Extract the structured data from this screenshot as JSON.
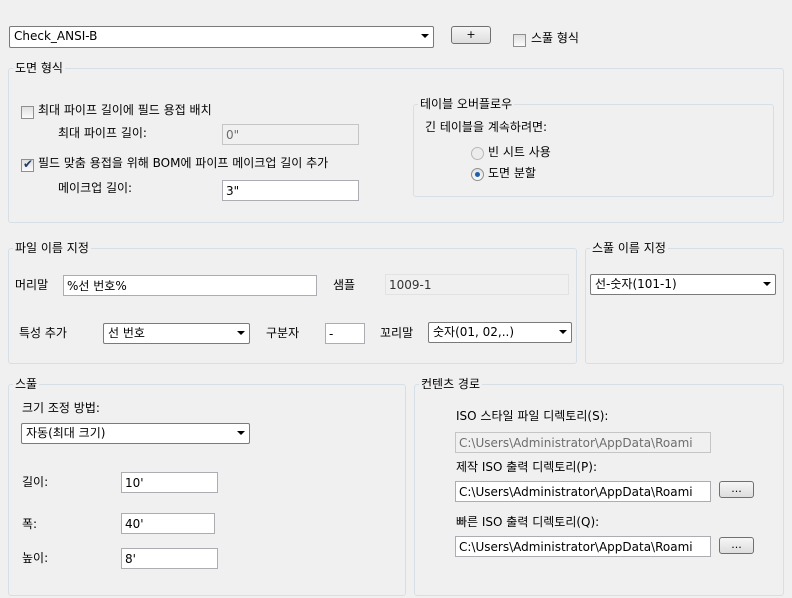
{
  "top": {
    "spool_combo": "Check_ANSI-B",
    "add_button": "+",
    "spool_format_label": "스풀 형식",
    "spool_format_checked": false
  },
  "drawing_format": {
    "title": "도면 형식",
    "field_weld_label": "최대 파이프 길이에 필드 용접 배치",
    "field_weld_checked": false,
    "max_pipe_label": "최대 파이프 길이:",
    "max_pipe_value": "0\"",
    "makeup_check_label": "필드 맞춤 용접을 위해 BOM에 파이프 메이크업 길이 추가",
    "makeup_checked": true,
    "makeup_length_label": "메이크업 길이:",
    "makeup_length_value": "3\""
  },
  "table_overflow": {
    "title": "테이블 오버플로우",
    "prompt": "긴 테이블을 계속하려면:",
    "option_blank": "빈 시트 사용",
    "option_split": "도면 분할",
    "selected": "split"
  },
  "file_naming": {
    "title": "파일 이름 지정",
    "prefix_label": "머리말",
    "prefix_value": "%선 번호%",
    "sample_label": "샘플",
    "sample_value": "1009-1",
    "property_label": "특성 추가",
    "property_value": "선 번호",
    "separator_label": "구분자",
    "separator_value": "-",
    "suffix_label": "꼬리말",
    "suffix_value": "숫자(01, 02,..)"
  },
  "spool_naming": {
    "title": "스풀 이름 지정",
    "combo_value": "선-숫자(101-1)"
  },
  "spool": {
    "title": "스풀",
    "sizing_label": "크기 조정 방법:",
    "sizing_value": "자동(최대 크기)",
    "length_label": "길이:",
    "length_value": "10'",
    "width_label": "폭:",
    "width_value": "40'",
    "height_label": "높이:",
    "height_value": "8'"
  },
  "content_path": {
    "title": "컨텐츠 경로",
    "iso_style_label": "ISO 스타일 파일 디렉토리(S):",
    "iso_style_value": "C:\\Users\\Administrator\\AppData\\Roami",
    "production_label": "제작 ISO 출력 디렉토리(P):",
    "production_value": "C:\\Users\\Administrator\\AppData\\Roami",
    "quick_label": "빠른 ISO 출력 디렉토리(Q):",
    "quick_value": "C:\\Users\\Administrator\\AppData\\Roami",
    "browse_label": "..."
  }
}
